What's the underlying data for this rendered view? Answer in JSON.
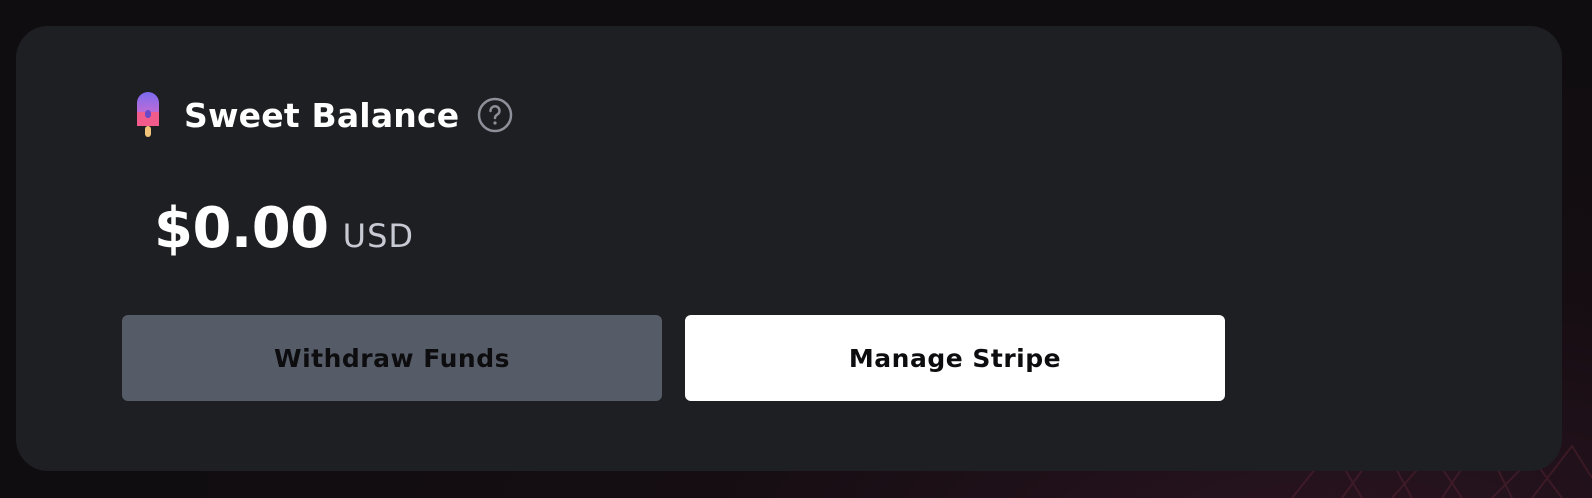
{
  "balance_card": {
    "title": "Sweet Balance",
    "title_icon": "popsicle-icon",
    "help_icon": "help-icon",
    "amount": "$0.00",
    "currency": "USD"
  },
  "actions": {
    "withdraw_label": "Withdraw Funds",
    "manage_stripe_label": "Manage Stripe"
  },
  "colors": {
    "card_background": "#1e1f23",
    "withdraw_button": "#555b67",
    "stripe_button": "#ffffff",
    "text_primary": "#ffffff",
    "text_secondary": "#c7c9d3"
  }
}
